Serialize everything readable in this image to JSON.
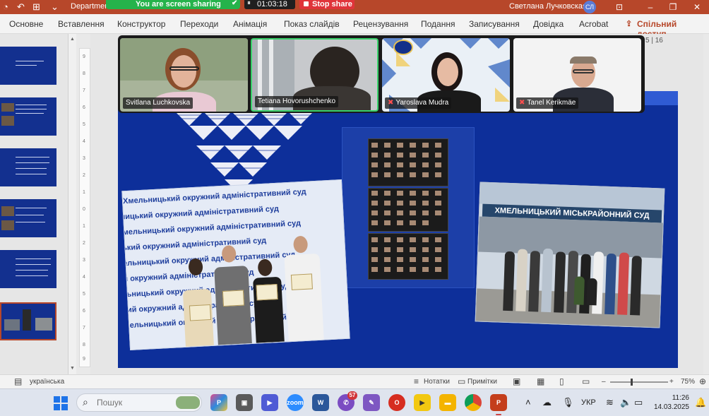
{
  "titlebar": {
    "doc_title": "Departmer",
    "sharing_banner": "You are screen sharing",
    "timer": "01:03:18",
    "stop_share": "Stop share",
    "user_name": "Светлана Лучковская",
    "user_initials": "СЛ"
  },
  "ribbon": {
    "tabs": [
      "Основне",
      "Вставлення",
      "Конструктор",
      "Переходи",
      "Анімація",
      "Показ слайдів",
      "Рецензування",
      "Подання",
      "Записування",
      "Довідка",
      "Acrobat"
    ],
    "share_label": "Спільний доступ"
  },
  "zoom_participants": [
    {
      "name": "Svitlana Luchkovska",
      "muted": false
    },
    {
      "name": "Tetiana Hovorushchenko",
      "muted": false
    },
    {
      "name": "Yaroslava Mudra",
      "muted": true
    },
    {
      "name": "Tanel Kerikmäe",
      "muted": true
    }
  ],
  "slide": {
    "page_indicator": "5 | 16",
    "banner_text": "Хмельницький окружний адміністративний суд",
    "court_sign": "ХМЕЛЬНИЦЬКИЙ МІСЬКРАЙОННИЙ СУД"
  },
  "vertical_ruler": [
    "9",
    "8",
    "7",
    "6",
    "5",
    "4",
    "3",
    "2",
    "1",
    "0",
    "1",
    "2",
    "3",
    "4",
    "5",
    "6",
    "7",
    "8",
    "9"
  ],
  "statusbar": {
    "language": "українська",
    "notes_label": "Нотатки",
    "comments_label": "Примітки",
    "zoom_level": "75%"
  },
  "taskbar": {
    "search_placeholder": "Пошук",
    "badge_count": "57",
    "language": "УКР",
    "time": "11:26",
    "date": "14.03.2025"
  },
  "colors": {
    "powerpoint_accent": "#b7472a",
    "slide_blue": "#0d2f9a",
    "zoom_green": "#25b34b",
    "stop_red": "#e0343a"
  }
}
